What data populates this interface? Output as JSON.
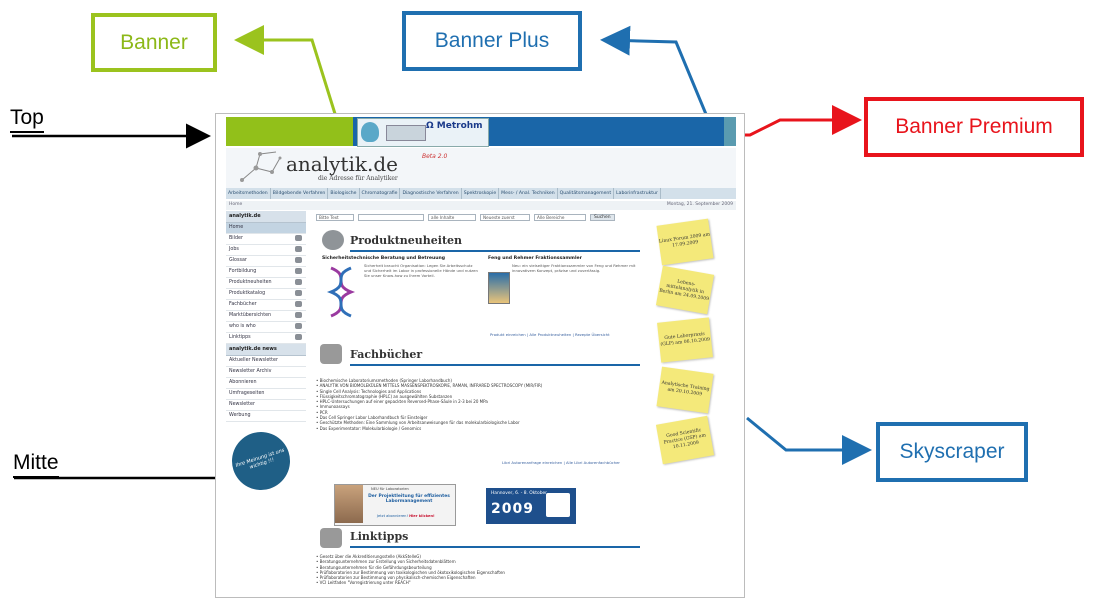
{
  "labels": {
    "banner": "Banner",
    "banner_plus": "Banner Plus",
    "banner_premium": "Banner Premium",
    "skyscraper": "Skyscraper",
    "top": "Top",
    "mitte": "Mitte"
  },
  "colors": {
    "banner": "#9bc31e",
    "banner_plus": "#1f6fb0",
    "banner_premium": "#e8141c",
    "skyscraper": "#1f6fb0"
  },
  "site": {
    "brand": "analytik.de",
    "tagline": "die Adresse für Analytiker",
    "beta": "Beta 2.0",
    "topbar_ad_logo": "Ω Metrohm",
    "nav": [
      "Arbeitsmethoden",
      "Bildgebende Verfahren",
      "Biologische",
      "Chromatografie",
      "Diagnostische Verfahren",
      "Spektroskopie",
      "Mess- / Anal. Techniken",
      "Qualitätsmanagement",
      "Laborinfrastruktur"
    ],
    "crumb_left": "Home",
    "crumb_right": "Montag, 21. September 2009",
    "left_header_1": "analytik.de",
    "left_items_1": [
      "Home",
      "Bilder",
      "Jobs",
      "Glossar",
      "Fortbildung",
      "Produktneuheiten",
      "Produktkatalog",
      "Fachbücher",
      "Marktübersichten",
      "who is who",
      "Linktipps"
    ],
    "left_header_2": "analytik.de news",
    "left_items_2": [
      "Aktueller Newsletter",
      "Newsletter Archiv",
      "Abonnieren",
      "Umfrageseiten",
      "Newsletter",
      "Werbung"
    ],
    "badge_text": "Ihre Meinung ist uns wichtig !!!",
    "search": {
      "field_placeholder": "Bitte Text",
      "select1": "alle Inhalte",
      "select2": "Neueste zuerst",
      "select3": "Alle Bereiche",
      "button": "Suchen"
    },
    "sections": {
      "produkt": "Produktneuheiten",
      "fach": "Fachbücher",
      "link": "Linktipps"
    },
    "pn_left_title": "Sicherheitstechnische Beratung und Betreuung",
    "pn_left_text": "Sicherheit braucht Organisation: Legen Sie Arbeitsschutz und Sicherheit im Labor in professionelle Hände und nutzen Sie unser Know-how zu Ihrem Vorteil.",
    "pn_right_title": "Feng und Rehmer Fraktionssammler",
    "pn_right_text": "Neu: ein vielseitiger Fraktionssammler von Feng und Rehmer mit innovativem Konzept, präzise und zuverlässig.",
    "pn_links": "Produkt einreichen | Alle Produktneuheiten | Rezepte Übersicht",
    "fach_items": [
      "Biochemische Laboratoriumsmethoden (Springer Laborhandbuch)",
      "ANALYTIK VON BIOMOLEKÜLEN MITTELS MASSENSPEKTROSKOPIE, RAMAN, INFRARED SPECTROSCOPY (MIR/FIR)",
      "Single Cell Analysis: Technologies and Applications",
      "Flüssigkeitschromatographie (HPLC) an ausgewählten Substanzen",
      "HPLC-Untersuchungen auf einer gepackten Reversed-Phase-Säule in 2-3 bei 20 MPa",
      "Immunoassays",
      "PCR",
      "Das Cell Springer Labor Laborhandbuch für Einsteiger",
      "Geschützte Methoden: Eine Sammlung von Arbeitsanweisungen für das molekularbiologische Labor",
      "Das Experimentator: Molekularbiologie / Genomics"
    ],
    "fach_links": "Libri Autorenanfrage einreichen | Alle Libri Autorenfachbücher",
    "sky_notes": [
      "Linux Forum 2009 am 17.09.2009",
      "Lebens- mittelanalytik in Berlin am 24.09.2009",
      "Gute Laborpraxis (GLP) am 06.10.2009",
      "Analytische Training am 20.10.2009",
      "Good Scientific Practice (GSP) am 10.11.2009"
    ],
    "ad_left": {
      "line1": "NEU für Laboratorien",
      "line2": "Der Projektleitung für effizientes Labormanagement",
      "line3": "Jetzt abonnieren!",
      "line3_b": "Hier klicken!"
    },
    "ad_right": {
      "date": "Hannover, 6. - 8. Oktober",
      "year": "2009"
    },
    "link_items": [
      "Gesetz über die Akkreditierungsstelle (AkkStelleG)",
      "Beratungsunternehmen zur Erstellung von Sicherheitsdatenblättern",
      "Beratungsunternehmen für die Gefährdungsbeurteilung",
      "Prüflaboratorien zur Bestimmung von toxikologischen und ökotoxikologischen Eigenschaften",
      "Prüflaboratorien zur Bestimmung von physikalisch-chemischen Eigenschaften",
      "VCI Leitfaden \"Vorregistrierung unter REACH\""
    ]
  }
}
